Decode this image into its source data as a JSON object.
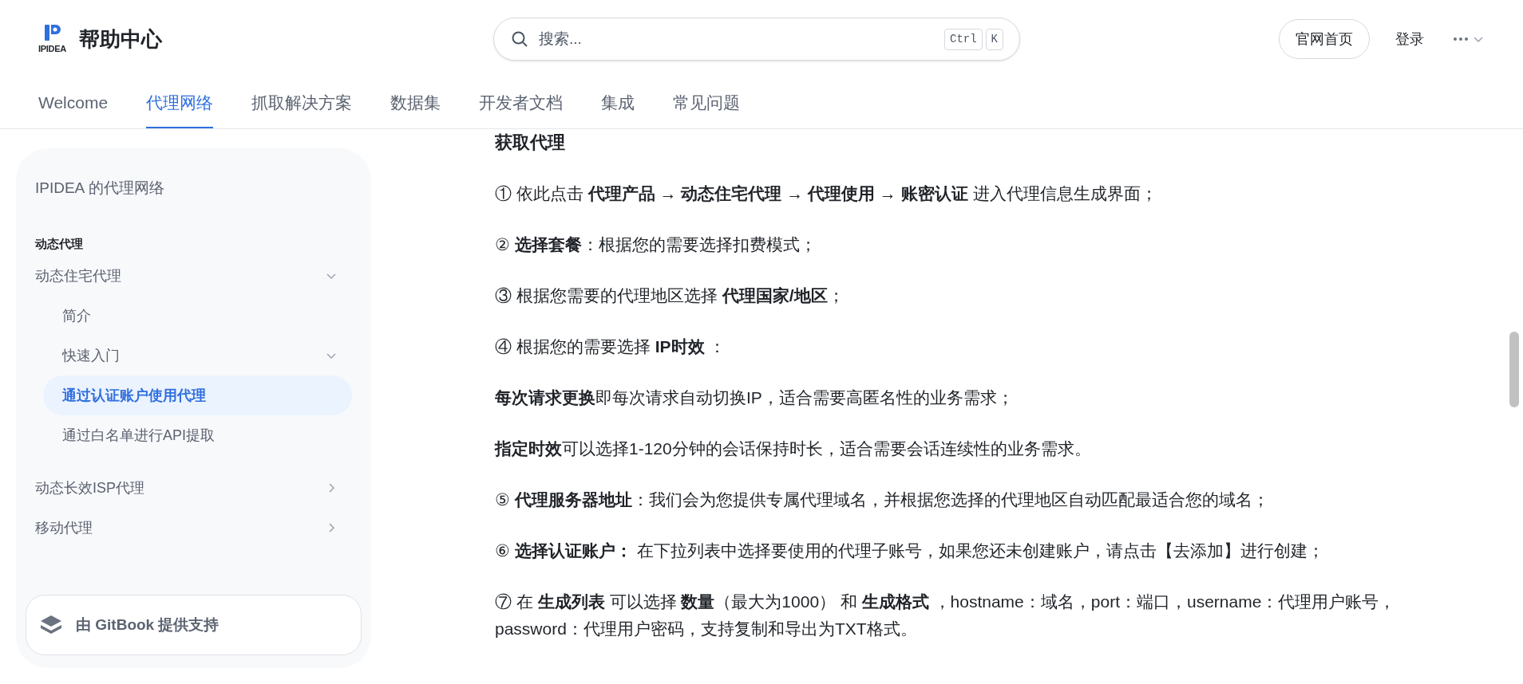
{
  "header": {
    "logo_text": "IPIDEA",
    "site_title": "帮助中心",
    "search": {
      "placeholder": "搜索...",
      "shortcut": [
        "Ctrl",
        "K"
      ]
    },
    "home_button": "官网首页",
    "login_link": "登录"
  },
  "tabs": [
    {
      "label": "Welcome",
      "selected": false
    },
    {
      "label": "代理网络",
      "selected": true
    },
    {
      "label": "抓取解决方案",
      "selected": false
    },
    {
      "label": "数据集",
      "selected": false
    },
    {
      "label": "开发者文档",
      "selected": false
    },
    {
      "label": "集成",
      "selected": false
    },
    {
      "label": "常见问题",
      "selected": false
    }
  ],
  "sidebar": {
    "title": "IPIDEA 的代理网络",
    "section": "动态代理",
    "items": [
      {
        "label": "动态住宅代理",
        "selected": false,
        "expanded": true,
        "children": [
          {
            "label": "简介",
            "selected": false
          },
          {
            "label": "快速入门",
            "selected": false,
            "expanded": true,
            "children": [
              {
                "label": "通过认证账户使用代理",
                "selected": true
              },
              {
                "label": "通过白名单进行API提取",
                "selected": false
              }
            ]
          }
        ]
      },
      {
        "label": "动态长效ISP代理",
        "selected": false,
        "expanded": false
      },
      {
        "label": "移动代理",
        "selected": false,
        "expanded": false
      }
    ],
    "footer": "由 GitBook 提供支持"
  },
  "content": {
    "heading": "获取代理",
    "paragraphs": [
      "① 依此点击 **代理产品 → 动态住宅代理 → 代理使用 → 账密认证** 进入代理信息生成界面；",
      "② **选择套餐**：根据您的需要选择扣费模式；",
      "③ 根据您需要的代理地区选择 **代理国家/地区**；",
      "④ 根据您的需要选择 **IP时效** ：",
      "**每次请求更换**即每次请求自动切换IP，适合需要高匿名性的业务需求；",
      "**指定时效**可以选择1-120分钟的会话保持时长，适合需要会话连续性的业务需求。",
      "⑤ **代理服务器地址**：我们会为您提供专属代理域名，并根据您选择的代理地区自动匹配最适合您的域名；",
      "⑥ **选择认证账户：** 在下拉列表中选择要使用的代理子账号，如果您还未创建账户，请点击【去添加】进行创建；",
      "⑦ 在 **生成列表** 可以选择 **数量**（最大为1000） 和 **生成格式** ，hostname：域名，port：端口，username：代理用户账号，password：代理用户密码，支持复制和导出为TXT格式。"
    ]
  }
}
